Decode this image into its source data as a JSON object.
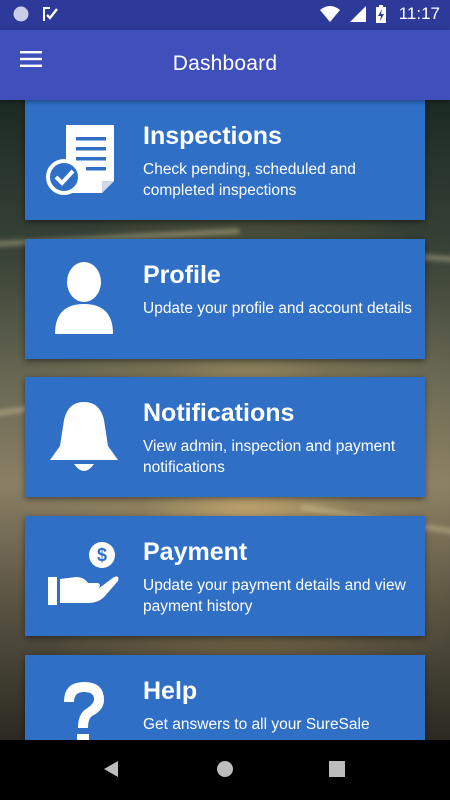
{
  "status_bar": {
    "time": "11:17",
    "icons": [
      "circle-notification-icon",
      "checkmark-notification-icon",
      "wifi-icon",
      "signal-icon",
      "battery-charging-icon"
    ]
  },
  "app_bar": {
    "title": "Dashboard",
    "menu_icon": "hamburger-menu-icon"
  },
  "cards": [
    {
      "title": "Inspections",
      "description": "Check pending, scheduled and completed inspections",
      "icon": "document-check-icon"
    },
    {
      "title": "Profile",
      "description": "Update your profile and account details",
      "icon": "person-icon"
    },
    {
      "title": "Notifications",
      "description": "View admin, inspection and payment notifications",
      "icon": "bell-icon"
    },
    {
      "title": "Payment",
      "description": "Update your payment details and view payment history",
      "icon": "hand-dollar-icon"
    },
    {
      "title": "Help",
      "description": "Get answers to all your SureSale",
      "icon": "question-mark-icon"
    }
  ],
  "nav_bar": {
    "buttons": [
      "back-icon",
      "home-icon",
      "recents-icon"
    ]
  },
  "colors": {
    "status_bar": "#2e3a99",
    "app_bar": "#3f4fbb",
    "card": "#2f6fc6"
  }
}
